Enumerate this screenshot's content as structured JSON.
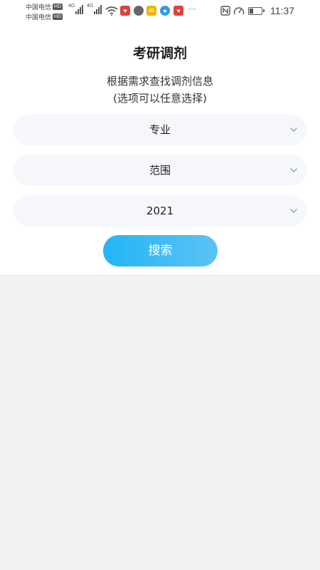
{
  "status_bar": {
    "carrier1": "中国电信",
    "carrier2": "中国电信",
    "hd_badge": "HD",
    "network_type": "4G",
    "more": "···",
    "time": "11:37",
    "battery_level": 0.35,
    "icons": [
      "signal-icon",
      "wifi-icon",
      "app-icon-heart",
      "chat-icon",
      "mail-icon",
      "browser-icon",
      "app-icon-heart",
      "more-icon",
      "nfc-icon",
      "speedometer-icon",
      "battery-icon"
    ]
  },
  "page": {
    "title": "考研调剂",
    "subtitle_line1": "根据需求查找调剂信息",
    "subtitle_line2": "(选项可以任意选择)"
  },
  "filters": {
    "major": {
      "value": "专业",
      "icon": "chevron-down-icon"
    },
    "scope": {
      "value": "范围",
      "icon": "chevron-down-icon"
    },
    "year": {
      "value": "2021",
      "icon": "chevron-down-icon"
    }
  },
  "search_button": {
    "label": "搜索",
    "colors": [
      "#22b5f6",
      "#5cc3f3"
    ]
  }
}
